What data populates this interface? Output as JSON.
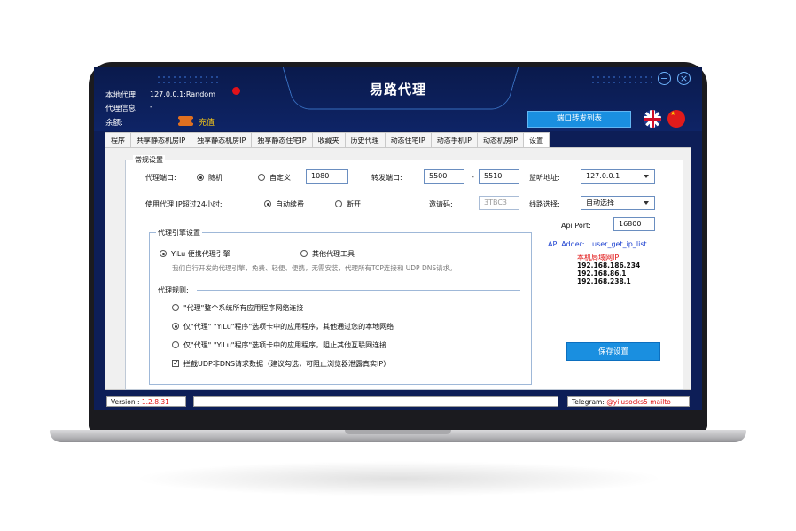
{
  "app": {
    "title": "易路代理"
  },
  "header": {
    "local_proxy_label": "本地代理:",
    "local_proxy_value": "127.0.0.1:Random",
    "proxy_info_label": "代理信息:",
    "proxy_info_value": "-",
    "balance_label": "余额:",
    "recharge_label": "充值",
    "port_forward_list_button": "端口转发列表",
    "minimize_symbol": "−",
    "close_symbol": "×",
    "cn_flag_stars": "★"
  },
  "tabs": [
    {
      "label": "程序"
    },
    {
      "label": "共享静态机房IP"
    },
    {
      "label": "独享静态机房IP"
    },
    {
      "label": "独享静态住宅IP"
    },
    {
      "label": "收藏夹"
    },
    {
      "label": "历史代理"
    },
    {
      "label": "动态住宅IP"
    },
    {
      "label": "动态手机IP"
    },
    {
      "label": "动态机房IP"
    },
    {
      "label": "设置",
      "active": true
    }
  ],
  "settings": {
    "general_group_title": "常规设置",
    "proxy_port_label": "代理端口:",
    "port_random_label": "随机",
    "port_random_selected": true,
    "port_custom_label": "自定义",
    "port_custom_value": "1080",
    "forward_port_label": "转发端口:",
    "forward_port_from": "5500",
    "forward_port_dash": "-",
    "forward_port_to": "5510",
    "listen_addr_label": "监听地址:",
    "listen_addr_value": "127.0.0.1",
    "over24h_label": "使用代理 IP超过24小时:",
    "auto_renew_label": "自动续费",
    "auto_renew_selected": true,
    "disconnect_label": "断开",
    "invite_code_label": "邀请码:",
    "invite_code_value": "3TBC3",
    "line_select_label": "线路选择:",
    "line_select_value": "自动选择",
    "api_port_label": "Api Port:",
    "api_port_value": "16800",
    "api_adder_label": "API Adder:",
    "api_adder_value": "user_get_ip_list",
    "lan_ip_title": "本机局域网IP:",
    "lan_ips": [
      "192.168.186.234",
      "192.168.86.1",
      "192.168.238.1"
    ],
    "engine_group_title": "代理引擎设置",
    "engine_yilu_label": "YiLu 便携代理引擎",
    "engine_yilu_selected": true,
    "engine_other_label": "其他代理工具",
    "engine_desc": "我们自行开发的代理引擎，免费、轻便、便携，无需安装，代理所有TCP连接和 UDP DNS请求。",
    "rules_group_title": "代理规则:",
    "rule1_label": "\"代理\"整个系统所有应用程序网络连接",
    "rule2_label": "仅\"代理\" \"YiLu\"程序\"选项卡中的应用程序，其他通过您的本地网络",
    "rule2_selected": true,
    "rule3_label": "仅\"代理\" \"YiLu\"程序\"选项卡中的应用程序，阻止其他互联网连接",
    "block_udp_label": "拦截UDP非DNS请求数据（建议勾选，可阻止浏览器泄露真实IP）",
    "block_udp_checked": true,
    "checkmark": "✓",
    "save_button": "保存设置"
  },
  "status_bar": {
    "version_label": "Version :",
    "version_value": "1.2.8.31",
    "telegram_label": "Telegram:",
    "telegram_value": "@yilusocks5",
    "mailto_label": "mailto"
  },
  "colors": {
    "header_bg": "#0e2466",
    "accent_blue": "#1a8fe0",
    "recharge": "#f5c518",
    "lan_ip_red": "#e01010",
    "api_blue": "#1a3fd0"
  }
}
